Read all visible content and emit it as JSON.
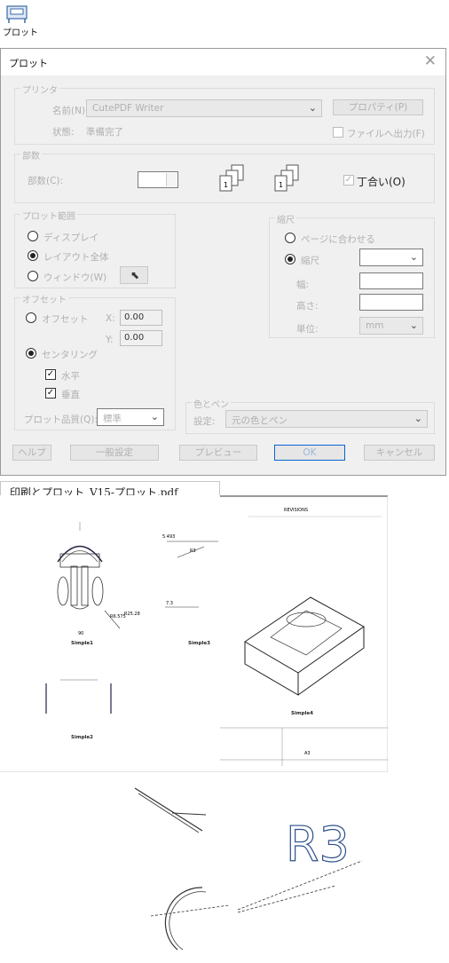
{
  "toolbar": {
    "plot_label": "プロット",
    "plot_icon": "plotter-icon"
  },
  "dialog": {
    "title": "プロット",
    "printer": {
      "group": "プリンタ",
      "name_label": "名前(N):",
      "name_value": "CutePDF Writer",
      "properties_button": "プロパティ(P)",
      "status_label": "状態:",
      "status_value": "準備完了",
      "print_to_file": "ファイルへ出力(F)"
    },
    "copies": {
      "group": "部数",
      "count_label": "部数(C):",
      "count_value": "1",
      "collate": "丁合い(O)",
      "collate_checked": true
    },
    "range": {
      "group": "プロット範囲",
      "options": [
        "ディスプレイ",
        "レイアウト全体",
        "ウィンドウ(W)"
      ],
      "selected": 1
    },
    "offset": {
      "group": "オフセット",
      "offset_option": "オフセット",
      "x_label": "X:",
      "x_value": "0.00",
      "y_label": "Y:",
      "y_value": "0.00",
      "center_option": "センタリング",
      "center_selected": true,
      "horizontal": "水平",
      "vertical": "垂直",
      "plot_quality_label": "プロット品質(Q):",
      "plot_quality_value": "標準"
    },
    "scale": {
      "group": "縮尺",
      "fit_option": "ページに合わせる",
      "scale_option": "縮尺",
      "scale_selected": true,
      "width_label": "幅:",
      "height_label": "高さ:",
      "unit_label": "単位:",
      "unit_value": "mm"
    },
    "pen": {
      "group": "色とペン",
      "label": "設定:",
      "value": "元の色とペン"
    },
    "buttons": {
      "help": "ヘルプ",
      "general": "一般設定",
      "preview": "プレビュー",
      "ok": "OK",
      "cancel": "キャンセル"
    }
  },
  "pdf": {
    "title": "印刷とプロット_V15-プロット.pdf",
    "sheet": {
      "header": "REVISIONS",
      "dim_5493": "5.493",
      "dim_r3": "R3",
      "dim_73": "7.3",
      "dim_r6": "R6.575",
      "dim_r25": "R25.28",
      "dim_90": "90",
      "view1": "Simple1",
      "view2": "Simple2",
      "view3": "Simple3",
      "view4": "Simple4",
      "titleblock_a3": "A3"
    },
    "zoom_label": "R3"
  }
}
